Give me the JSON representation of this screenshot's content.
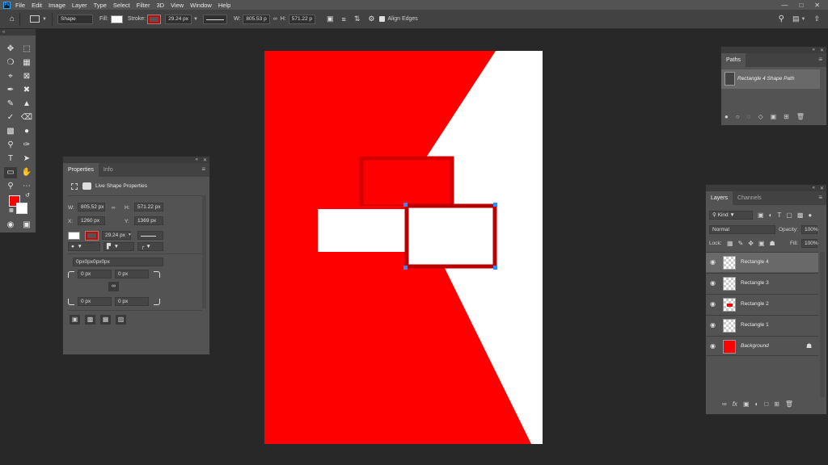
{
  "menu": {
    "items": [
      "File",
      "Edit",
      "Image",
      "Layer",
      "Type",
      "Select",
      "Filter",
      "3D",
      "View",
      "Window",
      "Help"
    ],
    "app_icon": "Ps",
    "window_controls": [
      "minimize-icon",
      "maximize-icon",
      "close-icon"
    ]
  },
  "options_bar": {
    "tool_mode": "Shape",
    "fill_label": "Fill:",
    "stroke_label": "Stroke:",
    "stroke_width": "29.24 px",
    "w_label": "W:",
    "w_value": "805.53 p",
    "h_label": "H:",
    "h_value": "571.22 p",
    "align_edges_label": "Align Edges",
    "fill_color": "#ffffff",
    "stroke_color": "#d40000"
  },
  "properties_panel": {
    "tabs": [
      "Properties",
      "Info"
    ],
    "header": "Live Shape Properties",
    "w_label": "W:",
    "w_value": "805.52 px",
    "h_label": "H:",
    "h_value": "571.22 px",
    "x_label": "X:",
    "x_value": "1260 px",
    "y_label": "Y:",
    "y_value": "1369 px",
    "stroke_width": "29.24 px",
    "corner_radii": "0px0px0px0px",
    "corner_tl": "0 px",
    "corner_tr": "0 px",
    "corner_bl": "0 px",
    "corner_br": "0 px"
  },
  "paths_panel": {
    "tab": "Paths",
    "items": [
      {
        "label": "Rectangle 4 Shape Path"
      }
    ]
  },
  "layers_panel": {
    "tabs": [
      "Layers",
      "Channels"
    ],
    "filter_kind": "Kind",
    "blend_mode": "Normal",
    "opacity_label": "Opacity:",
    "opacity_value": "100%",
    "lock_label": "Lock:",
    "fill_label": "Fill:",
    "fill_value": "100%",
    "layers": [
      {
        "name": "Rectangle 4",
        "selected": true
      },
      {
        "name": "Rectangle 3",
        "selected": false
      },
      {
        "name": "Rectangle 2",
        "selected": false
      },
      {
        "name": "Rectangle 1",
        "selected": false
      },
      {
        "name": "Background",
        "selected": false,
        "locked": true
      }
    ]
  },
  "colors": {
    "foreground": "#ff0000",
    "background": "#ffffff",
    "canvas_red": "#ff0000",
    "stroke_dark_red": "#d40000",
    "selection_blue": "#2f8cff"
  }
}
